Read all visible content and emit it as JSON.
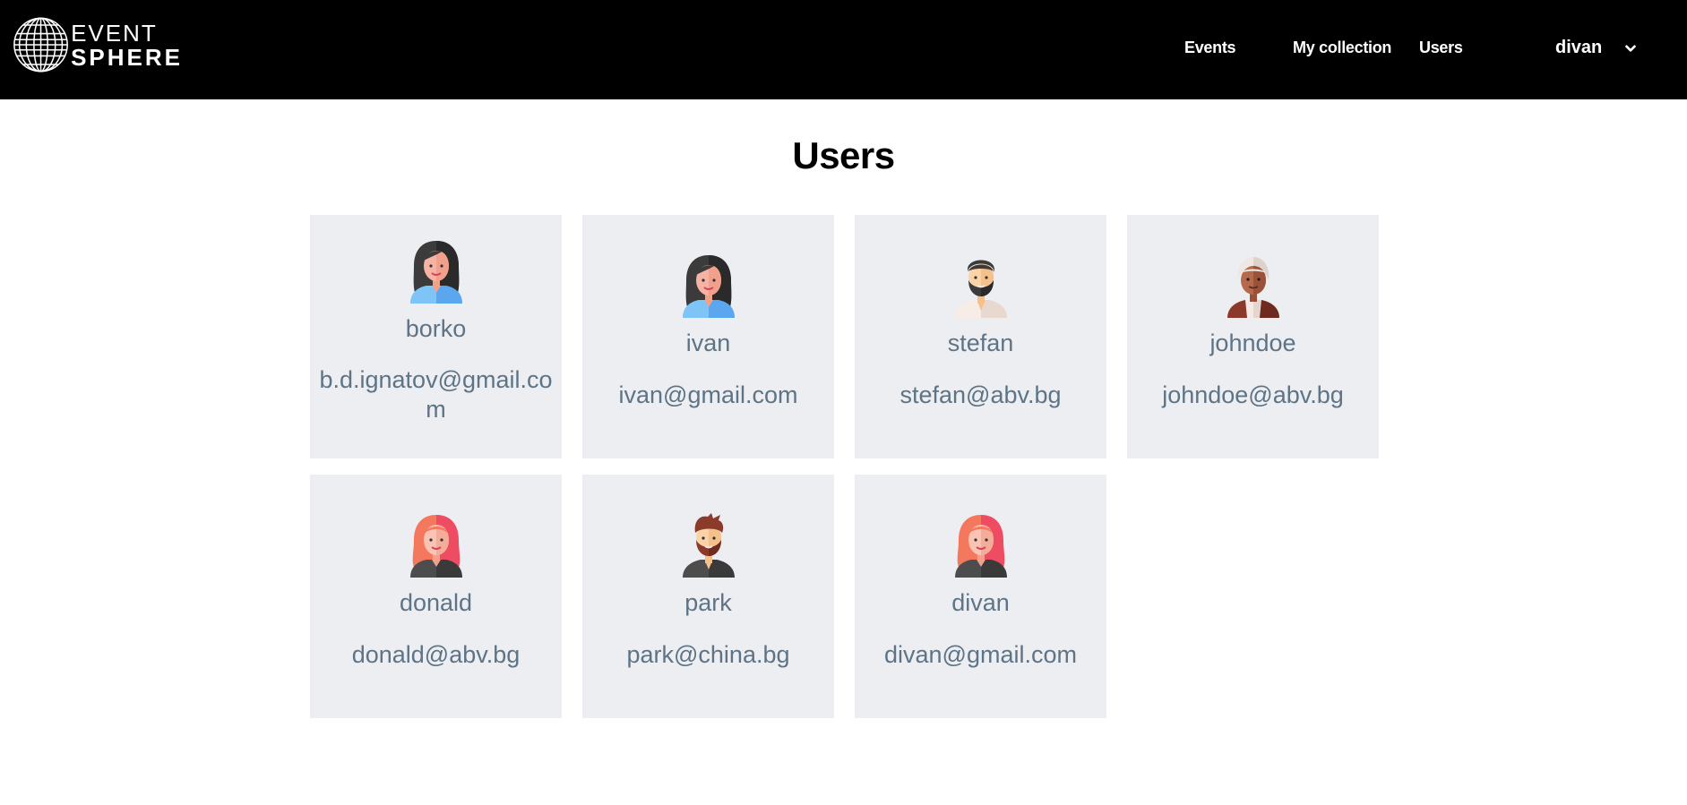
{
  "brand": {
    "line1": "EVENT",
    "line2": "SPHERE"
  },
  "nav": {
    "events": "Events",
    "collection": "My collection",
    "users": "Users",
    "current_user": "divan"
  },
  "page": {
    "title": "Users"
  },
  "users": [
    {
      "username": "borko",
      "email": "b.d.ignatov@gmail.com",
      "avatar": "woman-dark-hair-icon"
    },
    {
      "username": "ivan",
      "email": "ivan@gmail.com",
      "avatar": "woman-dark-hair-icon"
    },
    {
      "username": "stefan",
      "email": "stefan@abv.bg",
      "avatar": "man-beard-icon"
    },
    {
      "username": "johndoe",
      "email": "johndoe@abv.bg",
      "avatar": "elder-man-icon"
    },
    {
      "username": "donald",
      "email": "donald@abv.bg",
      "avatar": "woman-red-hair-icon"
    },
    {
      "username": "park",
      "email": "park@china.bg",
      "avatar": "man-red-beard-icon"
    },
    {
      "username": "divan",
      "email": "divan@gmail.com",
      "avatar": "woman-red-hair-icon"
    }
  ],
  "colors": {
    "navbar": "#000000",
    "card": "#eceef1",
    "card_text": "#5e7486"
  }
}
